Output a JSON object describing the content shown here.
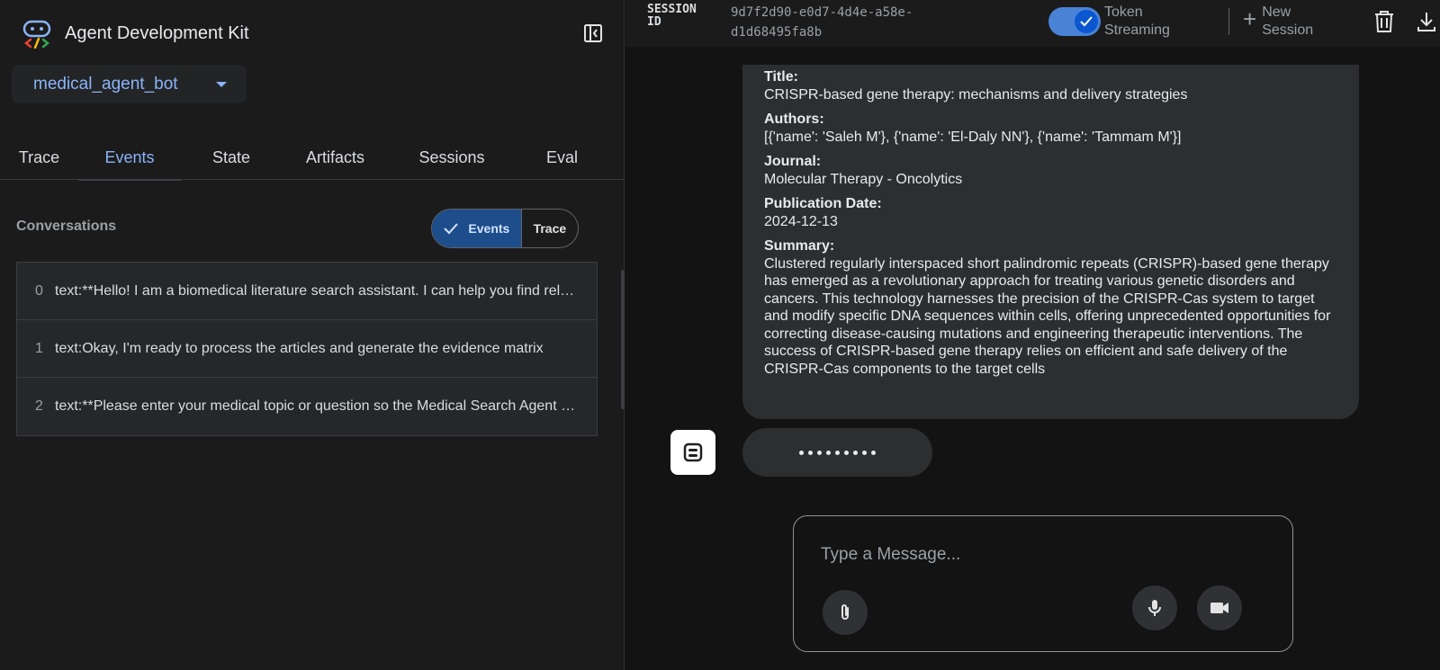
{
  "app": {
    "title": "Agent Development Kit"
  },
  "agent_selector": {
    "value": "medical_agent_bot"
  },
  "tabs": [
    {
      "label": "Trace"
    },
    {
      "label": "Events"
    },
    {
      "label": "State"
    },
    {
      "label": "Artifacts"
    },
    {
      "label": "Sessions"
    },
    {
      "label": "Eval"
    }
  ],
  "conversations": {
    "label": "Conversations",
    "toggle": {
      "events": "Events",
      "trace": "Trace"
    },
    "items": [
      {
        "index": "0",
        "text": "text:**Hello! I am a biomedical literature search assistant. I can help you find relevant articles"
      },
      {
        "index": "1",
        "text": "text:Okay, I'm ready to process the articles and generate the evidence matrix"
      },
      {
        "index": "2",
        "text": "text:**Please enter your medical topic or question so the Medical Search Agent can begin"
      }
    ]
  },
  "session": {
    "label": "SESSION ID",
    "id": "9d7f2d90-e0d7-4d4e-a58e-d1d68495fa8b",
    "token_streaming_label": "Token Streaming",
    "new_session_label": "New Session"
  },
  "message": {
    "fields": [
      {
        "key": "Title:",
        "value": "CRISPR-based gene therapy: mechanisms and delivery strategies"
      },
      {
        "key": "Authors:",
        "value": "[{'name': 'Saleh M'}, {'name': 'El-Daly NN'}, {'name': 'Tammam M'}]"
      },
      {
        "key": "Journal:",
        "value": "Molecular Therapy - Oncolytics"
      },
      {
        "key": "Publication Date:",
        "value": "2024-12-13"
      },
      {
        "key": "Summary:",
        "value": "Clustered regularly interspaced short palindromic repeats (CRISPR)-based gene therapy has emerged as a revolutionary approach for treating various genetic disorders and cancers. This technology harnesses the precision of the CRISPR-Cas system to target and modify specific DNA sequences within cells, offering unprecedented opportunities for correcting disease-causing mutations and engineering therapeutic interventions. The success of CRISPR-based gene therapy relies on efficient and safe delivery of the CRISPR-Cas components to the target cells"
      }
    ]
  },
  "composer": {
    "placeholder": "Type a Message..."
  },
  "icons": {
    "logo": "adk-logo-icon",
    "collapse": "sidebar-collapse-icon",
    "check": "check-icon",
    "plus": "plus-icon",
    "trash": "trash-icon",
    "download": "download-icon",
    "bot": "robot-icon",
    "attach": "paperclip-icon",
    "mic": "microphone-icon",
    "video": "videocam-icon"
  },
  "colors": {
    "accent": "#8ab4f8",
    "toggle_on": "#4a83d6",
    "segment_active": "#1e4d8c"
  }
}
